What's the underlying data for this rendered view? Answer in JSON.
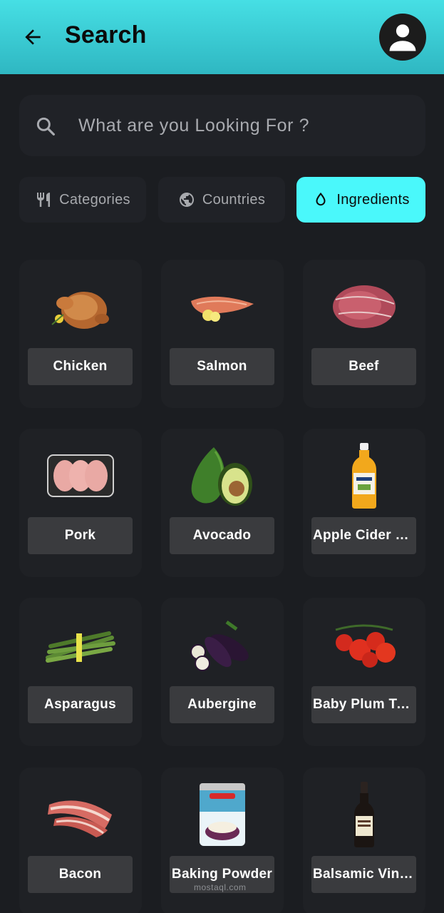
{
  "header": {
    "title": "Search",
    "back_icon": "arrow-left-icon",
    "avatar_icon": "person-icon",
    "gradient_top": "#46dfe4",
    "gradient_bottom": "#2fb7c2"
  },
  "search": {
    "placeholder": "What are you Looking For ?",
    "value": "",
    "icon": "search-icon"
  },
  "tabs": [
    {
      "label": "Categories",
      "icon": "fork-knife-icon",
      "active": false
    },
    {
      "label": "Countries",
      "icon": "globe-icon",
      "active": false
    },
    {
      "label": "Ingredients",
      "icon": "drop-icon",
      "active": true
    }
  ],
  "accent_color": "#4af8fb",
  "ingredients": [
    {
      "name": "Chicken",
      "image": "chicken"
    },
    {
      "name": "Salmon",
      "image": "salmon"
    },
    {
      "name": "Beef",
      "image": "beef"
    },
    {
      "name": "Pork",
      "image": "pork"
    },
    {
      "name": "Avocado",
      "image": "avocado"
    },
    {
      "name": "Apple Cider Vinegar",
      "image": "vinegar-bottle"
    },
    {
      "name": "Asparagus",
      "image": "asparagus"
    },
    {
      "name": "Aubergine",
      "image": "aubergine"
    },
    {
      "name": "Baby Plum Tomatoes",
      "image": "tomatoes"
    },
    {
      "name": "Bacon",
      "image": "bacon"
    },
    {
      "name": "Baking Powder",
      "image": "baking-powder-tin"
    },
    {
      "name": "Balsamic Vinegar",
      "image": "balsamic-bottle"
    }
  ],
  "watermark": "mostaql.com"
}
